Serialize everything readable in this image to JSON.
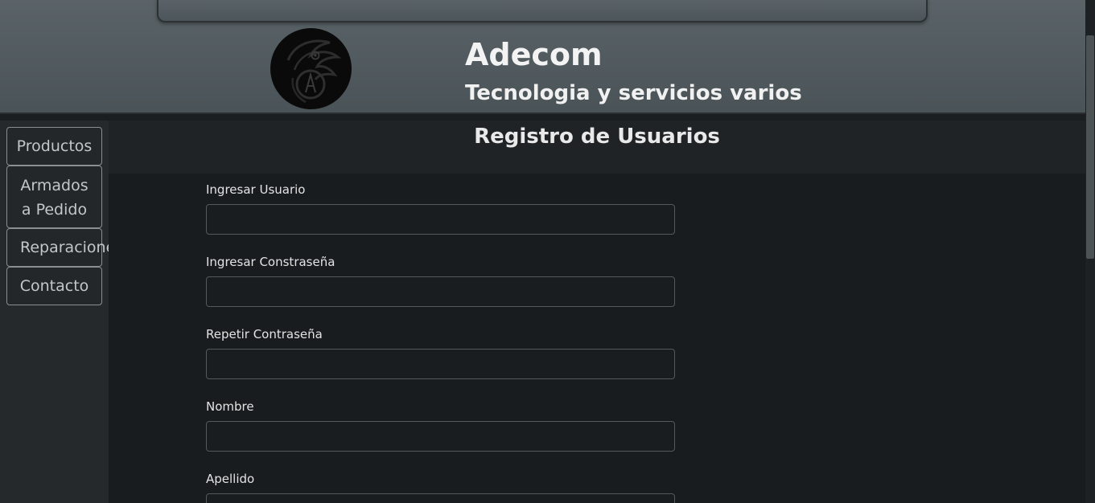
{
  "header": {
    "title": "Adecom",
    "subtitle": "Tecnologia y servicios varios",
    "logo_icon": "phoenix-logo-icon"
  },
  "sidebar": {
    "items": [
      {
        "label_line1": "Productos",
        "label_line2": ""
      },
      {
        "label_line1": "Armados",
        "label_line2": "a Pedido"
      },
      {
        "label_line1": "Reparaciones",
        "label_line2": ""
      },
      {
        "label_line1": "Contacto",
        "label_line2": ""
      }
    ]
  },
  "main": {
    "title": "Registro de Usuarios",
    "fields": [
      {
        "label": "Ingresar Usuario",
        "value": "",
        "placeholder": ""
      },
      {
        "label": "Ingresar Constraseña",
        "value": "",
        "placeholder": ""
      },
      {
        "label": "Repetir Contraseña",
        "value": "",
        "placeholder": ""
      },
      {
        "label": "Nombre",
        "value": "",
        "placeholder": ""
      },
      {
        "label": "Apellido",
        "value": "",
        "placeholder": ""
      }
    ]
  },
  "colors": {
    "header_bg": "#4f585c",
    "sidebar_bg": "#25292c",
    "main_bg": "#191c1e",
    "text": "#e6e6e6"
  }
}
